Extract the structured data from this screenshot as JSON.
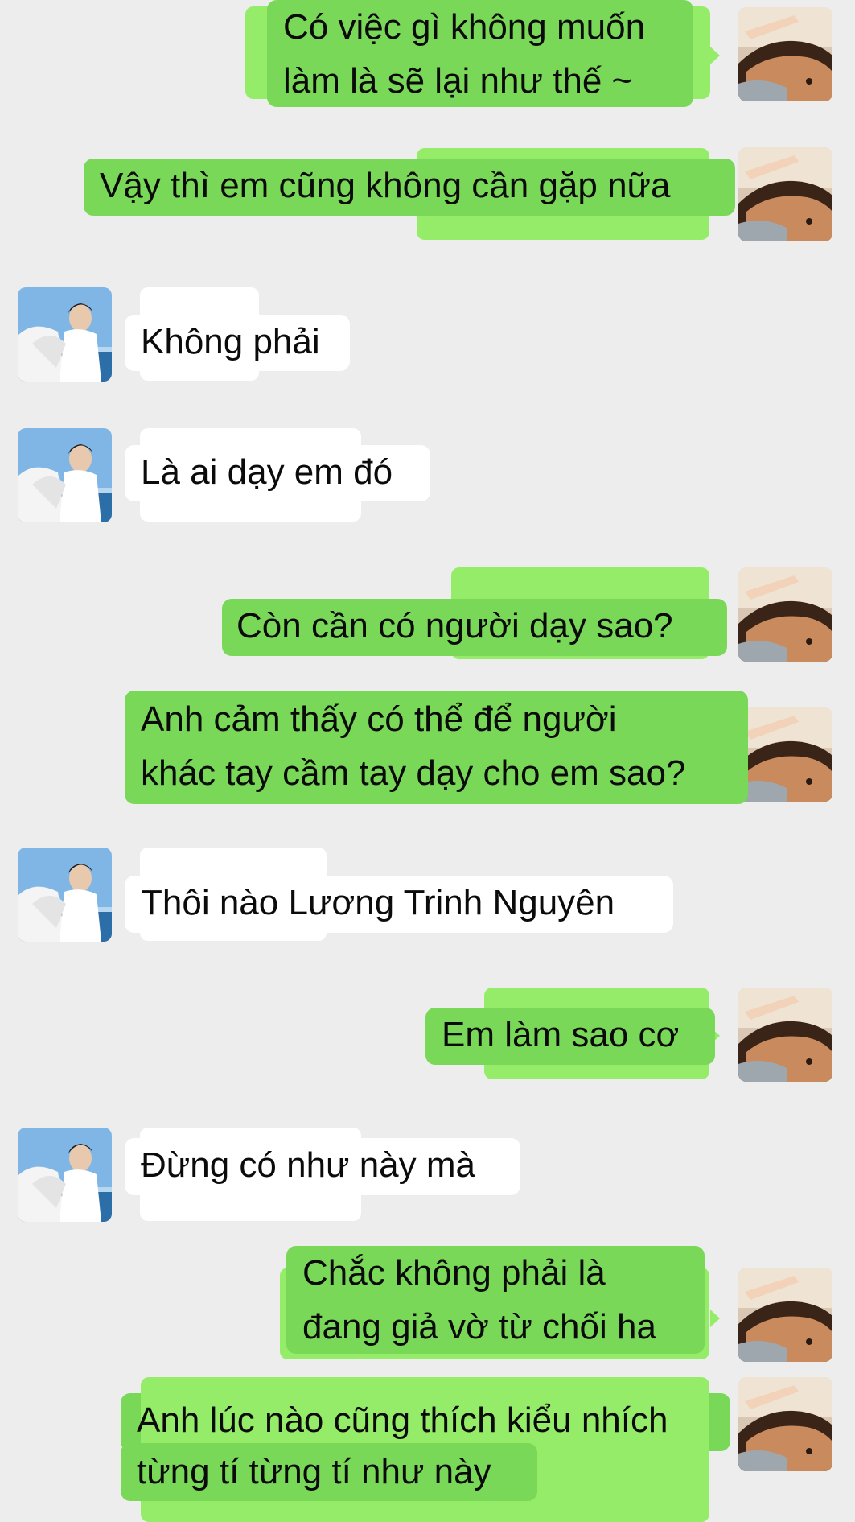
{
  "messages": [
    {
      "sender": "me",
      "text": "Có việc gì không muốn\nlàm là sẽ lại như thế ~"
    },
    {
      "sender": "me",
      "text": "Vậy thì em cũng không cần gặp nữa"
    },
    {
      "sender": "other",
      "text": "Không phải"
    },
    {
      "sender": "other",
      "text": "Là ai dạy em đó"
    },
    {
      "sender": "me",
      "text": "Còn cần có người dạy sao?"
    },
    {
      "sender": "me",
      "text": "Anh cảm thấy có thể để người\nkhác tay cầm tay dạy cho em sao?"
    },
    {
      "sender": "other",
      "text": "Thôi nào Lương Trinh Nguyên"
    },
    {
      "sender": "me",
      "text": "Em làm sao cơ"
    },
    {
      "sender": "other",
      "text": "Đừng có như này mà"
    },
    {
      "sender": "me",
      "text": "Chắc không phải là\nđang giả vờ từ chối ha"
    },
    {
      "sender": "me",
      "text": "Anh lúc nào cũng thích kiểu nhích\ntừng tí từng tí như này"
    }
  ],
  "colors": {
    "background": "#ededed",
    "bubble_me": "#7ad858",
    "bubble_me_shadow": "#95ec69",
    "bubble_other": "#ffffff"
  },
  "avatars": {
    "me": "avatar-person-hand-on-forehead",
    "other": "avatar-person-by-sea"
  }
}
